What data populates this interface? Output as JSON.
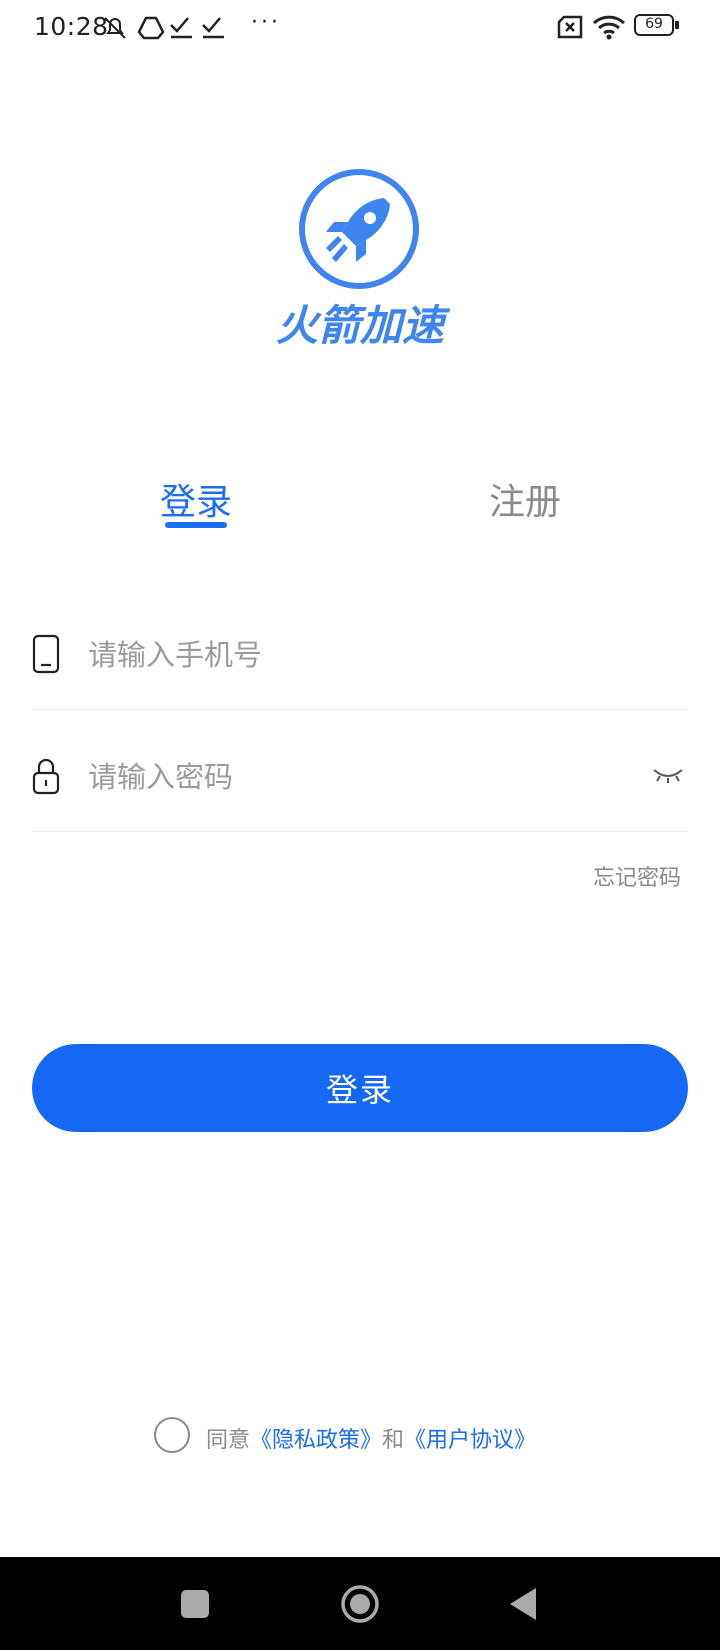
{
  "status_bar": {
    "time": "10:28",
    "left_icons": [
      "mute-icon",
      "drive-icon",
      "check-icon",
      "check-icon",
      "more-dots-icon"
    ],
    "more": "···",
    "right_icons": [
      "sim-x-icon",
      "wifi-icon",
      "battery-icon"
    ],
    "battery_level": "69"
  },
  "app": {
    "brand_name": "火箭加速",
    "accent_color": "#1a6df5"
  },
  "tabs": {
    "login": "登录",
    "register": "注册"
  },
  "form": {
    "phone_placeholder": "请输入手机号",
    "password_placeholder": "请输入密码",
    "forgot": "忘记密码",
    "submit": "登录"
  },
  "agreement": {
    "prefix": "同意",
    "privacy": "《隐私政策》",
    "and": "和",
    "terms": "《用户协议》"
  }
}
